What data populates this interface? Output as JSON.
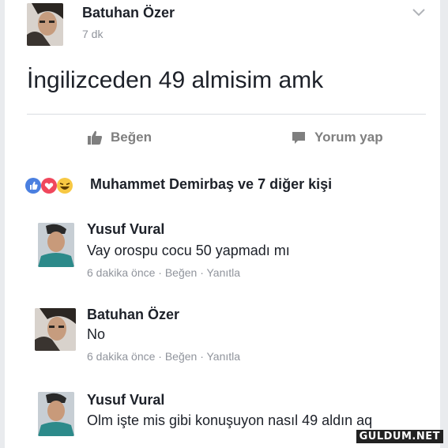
{
  "post": {
    "author": "Batuhan Özer",
    "time": "7 dk",
    "text": "İngilizceden 49 almisim amk",
    "like_label": "Beğen",
    "comment_label": "Yorum yap"
  },
  "reactions": {
    "text": "Muhammet Demirbaş ve 7 diğer kişi",
    "icons": [
      "like-icon",
      "love-icon",
      "haha-icon"
    ]
  },
  "comments": [
    {
      "author": "Yusuf Vural",
      "text": "Vay orospu cocu 50 yapmadı mı",
      "meta": "6 dakika önce · Beğen · Yanıtla"
    },
    {
      "author": "Batuhan Özer",
      "text": "No",
      "meta": "6 dakika önce · Beğen · Yanıtla"
    },
    {
      "author": "Yusuf Vural",
      "text": "Olm işte mis gibi konuşuyon nasıl 49 aldın aq"
    }
  ],
  "watermark": "GULDUM.NET",
  "colors": {
    "background": "#e9ebee",
    "card": "#ffffff",
    "like_blue": "#4a7fe0",
    "love_red": "#f0475c",
    "haha_yellow": "#f7c843",
    "muted_text": "#90949c"
  }
}
